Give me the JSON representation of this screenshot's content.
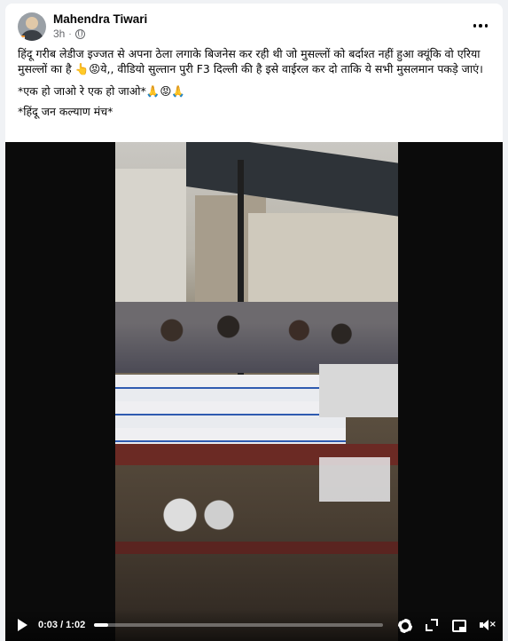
{
  "post": {
    "author": "Mahendra Tiwari",
    "time": "3h",
    "separator": "·",
    "body_paragraph": "हिंदू गरीब लेडीज इज्जत से अपना ठेला लगाके बिजनेस कर रही थी जो मुसल्लों को बर्दाश्त नहीं हुआ क्यूंकि वो एरिया मुसल्लों का है 👆😡ये,, वीडियो सुल्तान पुरी F3 दिल्ली की है इसे वाईरल कर दो ताकि ये सभी मुसलमान पकड़े जाएं।",
    "slogan_line": "*एक हो जाओ रे एक हो जाओ*🙏😡🙏",
    "org_line": "*हिंदू जन कल्याण  मंच*"
  },
  "video": {
    "current_time": "0:03",
    "duration": "1:02",
    "timecode": "0:03 / 1:02",
    "progress_fraction": 0.048
  },
  "icons": {
    "more": "more-horizontal-icon",
    "audience": "globe-icon",
    "play": "play-icon",
    "settings": "gear-icon",
    "fullscreen": "expand-icon",
    "pip": "pip-icon",
    "volume": "volume-muted-icon"
  }
}
